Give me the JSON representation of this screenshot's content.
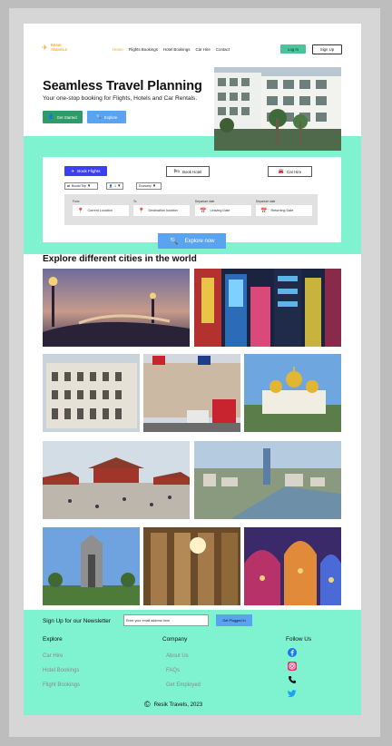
{
  "header": {
    "logo_text": [
      "RESIK",
      "TRAVELS"
    ],
    "nav": [
      {
        "label": "Home",
        "active": true
      },
      {
        "label": "Flights Bookings",
        "active": false
      },
      {
        "label": "Hotel Bookings",
        "active": false
      },
      {
        "label": "Car Hire",
        "active": false
      },
      {
        "label": "Contact",
        "active": false
      }
    ],
    "login_label": "Log In",
    "signup_label": "Sign Up"
  },
  "hero": {
    "title": "Seamless Travel Planning",
    "subtitle": "Your one-stop booking for Flights, Hotels and Car Rentals.",
    "get_started_label": "Get Started",
    "explore_label": "Explore"
  },
  "search": {
    "tabs": {
      "flights": "Book Flights",
      "hotel": "Book Hotel",
      "car": "Car Hire"
    },
    "trip_type": "Round Trip",
    "passengers": "1",
    "cabin_class": "Economy",
    "labels": {
      "from": "From",
      "to": "To",
      "departure": "Departure date",
      "return": "Departure date"
    },
    "placeholders": {
      "from": "Current Location",
      "to": "Destination location",
      "departure": "Leaving Date",
      "return": "Returning Date"
    },
    "explore_now_label": "Explore now"
  },
  "cities": {
    "title": "Explore different cities in the world"
  },
  "footer": {
    "newsletter_label": "Sign Up for our Newsletter",
    "newsletter_placeholder": "Enter your email address here",
    "newsletter_button": "Get Plugged In",
    "explore_heading": "Explore",
    "explore_links": [
      "Car Hire",
      "Hotel Bookings",
      "Flight Bookings"
    ],
    "company_heading": "Company",
    "company_links": [
      "About Us",
      "FAQs",
      "Get Employed"
    ],
    "follow_heading": "Follow Us",
    "social_icons": [
      "facebook-icon",
      "instagram-icon",
      "phone-icon",
      "twitter-icon"
    ],
    "copyright": "Resik Travels, 2023"
  },
  "colors": {
    "accent": "#f5a623",
    "mint": "#7ff2cf",
    "green": "#2f9b6a",
    "blue": "#5aa3f0",
    "flight_tab": "#3b3ff0"
  }
}
